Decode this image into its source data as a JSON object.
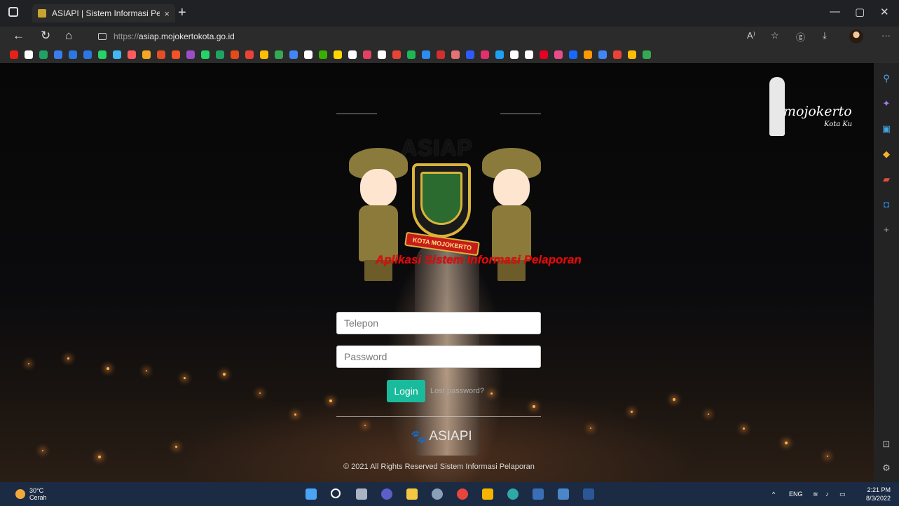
{
  "browser": {
    "tab_title": "ASIAPI | Sistem Informasi Pelapo",
    "tab_close": "×",
    "new_tab": "+",
    "url_protocol": "https://",
    "url_host": "asiap.mojokertokota.go.id",
    "read_aloud": "A⁾",
    "more": "···",
    "minimize": "—",
    "restore": "▢",
    "close": "✕"
  },
  "favorites_colors": [
    "#e62117",
    "#ffffff",
    "#1fa463",
    "#3b7ded",
    "#2b78e4",
    "#2b78e4",
    "#25d366",
    "#42b8f5",
    "#ff5a5f",
    "#f6a623",
    "#e44d26",
    "#f35325",
    "#9b4dca",
    "#25d366",
    "#1fa463",
    "#e64a19",
    "#ea4335",
    "#fbbc05",
    "#34a853",
    "#4285f4",
    "#ffffff",
    "#38b000",
    "#ffd600",
    "#ffffff",
    "#e4405f",
    "#ffffff",
    "#ea4335",
    "#1db954",
    "#2d8cf0",
    "#d32f2f",
    "#e57373",
    "#2d5bff",
    "#e1306c",
    "#1da1f2",
    "#ffffff",
    "#ffffff",
    "#e60023",
    "#ea4c89",
    "#1769ff",
    "#ff9900",
    "#4285f4",
    "#ea4335",
    "#fbbc05",
    "#34a853"
  ],
  "branding": {
    "city_logo_text": "mojokerto",
    "city_logo_sub": "Kota Ku"
  },
  "logo": {
    "title": "ASIAP",
    "ribbon": "KOTA MOJOKERTO",
    "tagline": "Aplikasi Sistem Informasi Pelaporan"
  },
  "form": {
    "phone_placeholder": "Telepon",
    "password_placeholder": "Password",
    "login_label": "Login",
    "lost_password": "Lost password?"
  },
  "footer": {
    "brand": "ASIAPI",
    "copyright": "© 2021 All Rights Reserved Sistem Informasi Pelaporan"
  },
  "taskbar": {
    "temperature": "30°C",
    "weather": "Cerah",
    "language": "ENG",
    "time": "2:21 PM",
    "date": "8/3/2022"
  },
  "colors": {
    "login_button": "#1abb9c",
    "tagline_red": "#e30b0b",
    "taskbar": "#1c2b44"
  }
}
